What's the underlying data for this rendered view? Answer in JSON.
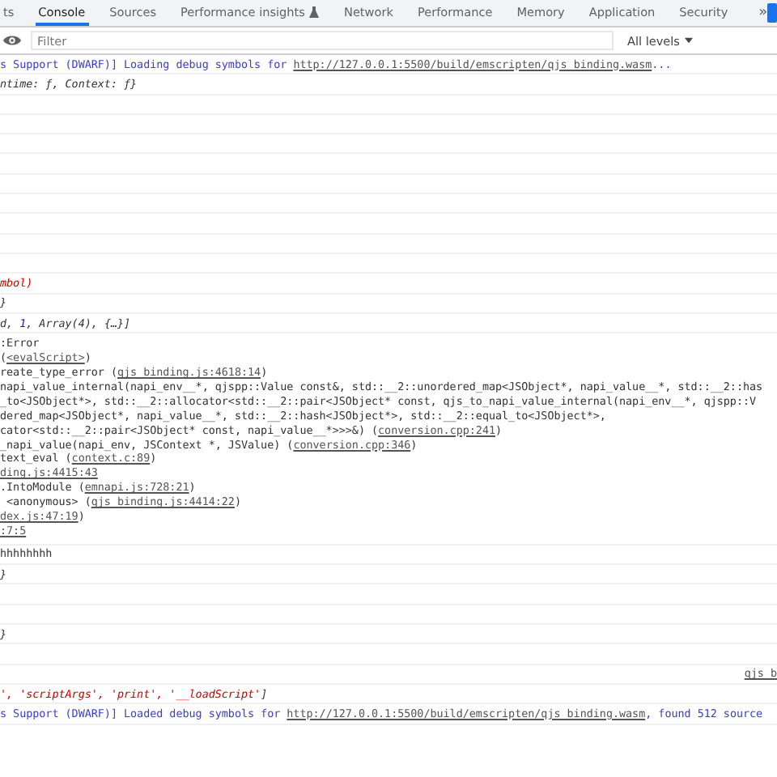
{
  "tabs": [
    {
      "label": "ts",
      "selected": false
    },
    {
      "label": "Console",
      "selected": true
    },
    {
      "label": "Sources",
      "selected": false
    },
    {
      "label": "Performance insights",
      "selected": false,
      "flask": true
    },
    {
      "label": "Network",
      "selected": false
    },
    {
      "label": "Performance",
      "selected": false
    },
    {
      "label": "Memory",
      "selected": false
    },
    {
      "label": "Application",
      "selected": false
    },
    {
      "label": "Security",
      "selected": false
    }
  ],
  "more_tabs": "»",
  "toolbar": {
    "filter": {
      "placeholder": "Filter"
    },
    "levels": "All levels"
  },
  "console": [
    {
      "kind": "info",
      "parts": [
        {
          "kind": "plain",
          "text": "s Support (DWARF)] Loading debug symbols for "
        },
        {
          "kind": "link",
          "text": "http://127.0.0.1:5500/build/emscripten/qjs_binding.wasm"
        },
        {
          "kind": "plain",
          "text": "..."
        }
      ]
    },
    {
      "kind": "log",
      "parts": [
        {
          "kind": "italic",
          "text": "ntime: ƒ, Context: ƒ}"
        }
      ]
    },
    {
      "kind": "blank"
    },
    {
      "kind": "blank"
    },
    {
      "kind": "blank"
    },
    {
      "kind": "blank"
    },
    {
      "kind": "blank"
    },
    {
      "kind": "blank"
    },
    {
      "kind": "blank"
    },
    {
      "kind": "blank"
    },
    {
      "kind": "blank"
    },
    {
      "kind": "log",
      "parts": [
        {
          "kind": "string",
          "text": "mbol)"
        }
      ]
    },
    {
      "kind": "log",
      "parts": [
        {
          "kind": "italic",
          "text": "}"
        }
      ]
    },
    {
      "kind": "log",
      "parts": [
        {
          "kind": "italic",
          "text": "d, "
        },
        {
          "kind": "number",
          "text": "1"
        },
        {
          "kind": "italic",
          "text": ", Array(4), {…}]"
        }
      ]
    },
    {
      "kind": "stack",
      "lines": [
        [
          {
            "kind": "plain",
            "text": ":Error"
          }
        ],
        [
          {
            "kind": "plain",
            "text": "("
          },
          {
            "kind": "link",
            "text": "<evalScript>"
          },
          {
            "kind": "plain",
            "text": ")"
          }
        ],
        [
          {
            "kind": "plain",
            "text": "reate_type_error ("
          },
          {
            "kind": "link",
            "text": "qjs_binding.js:4618:14"
          },
          {
            "kind": "plain",
            "text": ")"
          }
        ],
        [
          {
            "kind": "plain",
            "text": "napi_value_internal(napi_env__*, qjspp::Value const&, std::__2::unordered_map<JSObject*, napi_value__*, std::__2::has"
          }
        ],
        [
          {
            "kind": "plain",
            "text": "_to<JSObject*>, std::__2::allocator<std::__2::pair<JSObject* const, qjs_to_napi_value_internal(napi_env__*, qjspp::V"
          }
        ],
        [
          {
            "kind": "plain",
            "text": "dered_map<JSObject*, napi_value__*, std::__2::hash<JSObject*>, std::__2::equal_to<JSObject*>,"
          }
        ],
        [
          {
            "kind": "plain",
            "text": "cator<std::__2::pair<JSObject* const, napi_value__*>>>&) ("
          },
          {
            "kind": "link",
            "text": "conversion.cpp:241"
          },
          {
            "kind": "plain",
            "text": ")"
          }
        ],
        [
          {
            "kind": "plain",
            "text": "_napi_value(napi_env, JSContext *, JSValue) ("
          },
          {
            "kind": "link",
            "text": "conversion.cpp:346"
          },
          {
            "kind": "plain",
            "text": ")"
          }
        ],
        [
          {
            "kind": "plain",
            "text": "text_eval ("
          },
          {
            "kind": "link",
            "text": "context.c:89"
          },
          {
            "kind": "plain",
            "text": ")"
          }
        ],
        [
          {
            "kind": "link",
            "text": "ding.js:4415:43"
          }
        ],
        [
          {
            "kind": "plain",
            "text": ".IntoModule ("
          },
          {
            "kind": "link",
            "text": "emnapi.js:728:21"
          },
          {
            "kind": "plain",
            "text": ")"
          }
        ],
        [
          {
            "kind": "plain",
            "text": " <anonymous> ("
          },
          {
            "kind": "link",
            "text": "qjs_binding.js:4414:22"
          },
          {
            "kind": "plain",
            "text": ")"
          }
        ],
        [
          {
            "kind": "link",
            "text": "dex.js:47:19"
          },
          {
            "kind": "plain",
            "text": ")"
          }
        ],
        [
          {
            "kind": "link",
            "text": ":7:5"
          }
        ]
      ]
    },
    {
      "kind": "log",
      "parts": [
        {
          "kind": "plain",
          "text": "hhhhhhhh"
        }
      ]
    },
    {
      "kind": "log",
      "parts": [
        {
          "kind": "italic",
          "text": "}"
        }
      ]
    },
    {
      "kind": "blank"
    },
    {
      "kind": "blank"
    },
    {
      "kind": "log",
      "parts": [
        {
          "kind": "italic",
          "text": "}"
        }
      ]
    },
    {
      "kind": "blank"
    },
    {
      "kind": "source",
      "source": "qjs_b"
    },
    {
      "kind": "log",
      "parts": [
        {
          "kind": "string",
          "text": "', 'scriptArgs', 'print', '__loadScript'"
        },
        {
          "kind": "italic",
          "text": "]"
        }
      ]
    },
    {
      "kind": "info",
      "parts": [
        {
          "kind": "plain",
          "text": "s Support (DWARF)] Loaded debug symbols for "
        },
        {
          "kind": "link",
          "text": "http://127.0.0.1:5500/build/emscripten/qjs_binding.wasm"
        },
        {
          "kind": "plain",
          "text": ", found 512 source"
        }
      ]
    }
  ]
}
